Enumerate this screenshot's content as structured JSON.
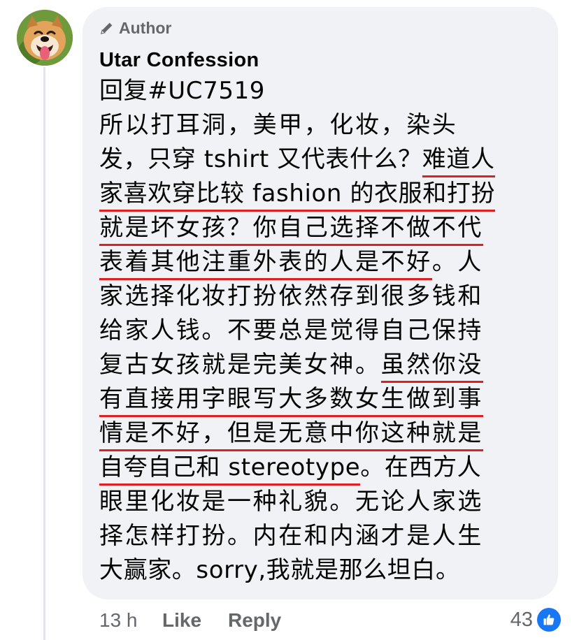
{
  "comment": {
    "badge": "Author",
    "author": "Utar Confession",
    "lines": [
      {
        "text": "回复#UC7519"
      },
      {
        "text": "所以打耳洞，美甲，化妆，染头"
      },
      {
        "pre": "发，只穿 tshirt 又代表什么？",
        "hl": "难道人"
      },
      {
        "hl": "家喜欢穿比较 fashion 的衣服和打扮"
      },
      {
        "hl": "就是坏女孩？你自己选择不做不代"
      },
      {
        "hl": "表着其他注重外表的人是不好",
        "post": "。人"
      },
      {
        "text": "家选择化妆打扮依然存到很多钱和"
      },
      {
        "text": "给家人钱。不要总是觉得自己保持"
      },
      {
        "pre": "复古女孩就是完美女神。",
        "hl": "虽然你没"
      },
      {
        "hl": "有直接用字眼写大多数女生做到事"
      },
      {
        "hl": "情是不好，但是无意中你这种就是"
      },
      {
        "hl": "自夸自己和 stereotype",
        "post": "。在西方人"
      },
      {
        "text": "眼里化妆是一种礼貌。无论人家选"
      },
      {
        "text": "择怎样打扮。内在和内涵才是人生"
      },
      {
        "text": "大赢家。sorry,我就是那么坦白。"
      }
    ]
  },
  "meta": {
    "time": "13 h",
    "like_label": "Like",
    "reply_label": "Reply",
    "reaction_count": "43",
    "reaction_icon": "thumbs-up-icon"
  },
  "colors": {
    "bubble": "#f0f2f5",
    "highlight_underline": "#e02020",
    "meta_text": "#65676b",
    "like_blue": "#1877f2"
  }
}
